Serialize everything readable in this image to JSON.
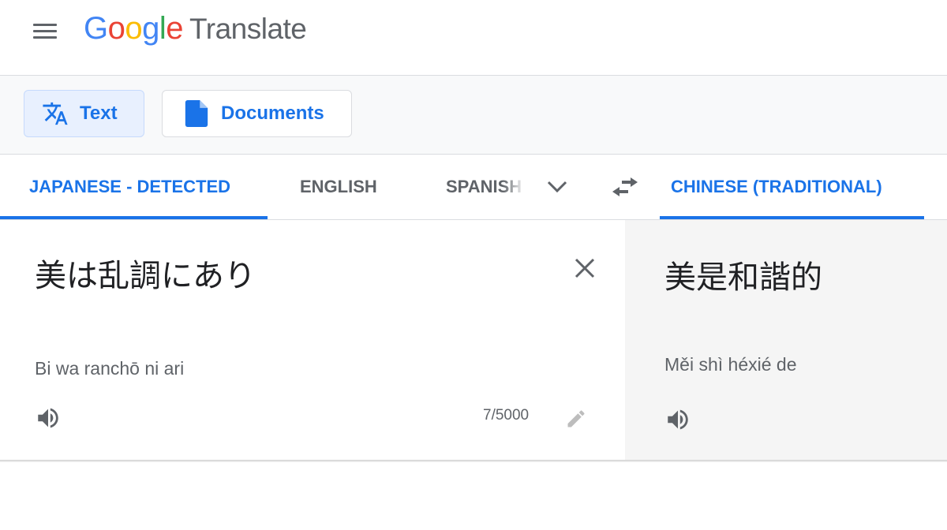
{
  "header": {
    "brand_letters": [
      {
        "char": "G",
        "color": "#4285F4"
      },
      {
        "char": "o",
        "color": "#EA4335"
      },
      {
        "char": "o",
        "color": "#FBBC05"
      },
      {
        "char": "g",
        "color": "#4285F4"
      },
      {
        "char": "l",
        "color": "#34A853"
      },
      {
        "char": "e",
        "color": "#EA4335"
      }
    ],
    "product_name": "Translate",
    "menu_icon": "hamburger-menu-icon"
  },
  "modes": {
    "text_label": "Text",
    "text_icon": "translate-icon",
    "documents_label": "Documents",
    "documents_icon": "document-icon"
  },
  "source_languages": [
    {
      "label": "JAPANESE - DETECTED",
      "active": true
    },
    {
      "label": "ENGLISH",
      "active": false
    },
    {
      "label": "SPANISH",
      "active": false
    }
  ],
  "target_languages": [
    {
      "label": "CHINESE (TRADITIONAL)",
      "active": true
    }
  ],
  "source": {
    "text": "美は乱調にあり",
    "transliteration": "Bi wa ranchō ni ari",
    "char_count": "7/5000"
  },
  "target": {
    "text": "美是和諧的",
    "transliteration": "Měi shì héxié de"
  },
  "colors": {
    "accent": "#1a73e8",
    "icon_gray": "#5f6368",
    "target_bg": "#f5f5f5"
  }
}
